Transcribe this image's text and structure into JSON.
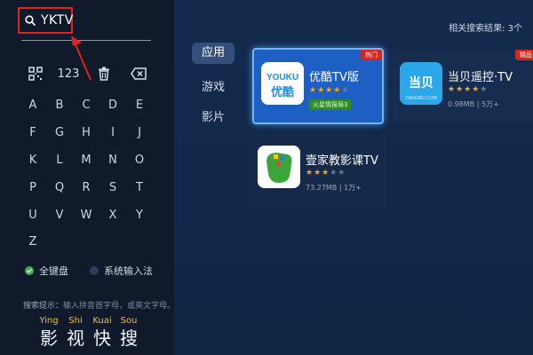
{
  "search": {
    "query": "YKTV",
    "icon": "search-icon"
  },
  "toolbar": {
    "qr_icon": "qr-code-icon",
    "numeric_label": "123",
    "trash_icon": "trash-icon",
    "backspace_icon": "backspace-icon"
  },
  "keyboard": {
    "rows": [
      [
        "A",
        "B",
        "C",
        "D",
        "E",
        "F"
      ],
      [
        "G",
        "H",
        "I",
        "J",
        "K",
        "L"
      ],
      [
        "M",
        "N",
        "O",
        "P",
        "Q",
        "R"
      ],
      [
        "S",
        "T",
        "U",
        "V",
        "W",
        "X"
      ],
      [
        "Y",
        "Z",
        "",
        "",
        "",
        ""
      ]
    ],
    "keys_col1": [
      "A",
      "G",
      "M",
      "S",
      "Y",
      "Z"
    ],
    "keys": {
      "A": "A",
      "B": "B",
      "C": "C",
      "D": "D",
      "E": "E",
      "F": "F",
      "G": "G",
      "H": "H",
      "I": "I",
      "J": "J",
      "K": "K",
      "L": "L",
      "M": "M",
      "N": "N",
      "O": "O",
      "P": "P",
      "Q": "Q",
      "R": "R",
      "S": "S",
      "T": "T",
      "U": "U",
      "V": "V",
      "W": "W",
      "X": "X",
      "Y": "Y",
      "Z": "Z"
    }
  },
  "input_modes": {
    "full_keyboard": "全键盘",
    "system_ime": "系统输入法",
    "selected": "full_keyboard"
  },
  "hint": {
    "label": "搜索提示：",
    "text": "输入拼音首字母，或英文字母。"
  },
  "pinyin_examples": [
    {
      "pinyin": "Ying",
      "hanzi": "影"
    },
    {
      "pinyin": "Shi",
      "hanzi": "视"
    },
    {
      "pinyin": "Kuai",
      "hanzi": "快"
    },
    {
      "pinyin": "Sou",
      "hanzi": "搜"
    }
  ],
  "results": {
    "count_label": "相关搜索结果: 3个"
  },
  "categories": [
    {
      "label": "应用",
      "active": true
    },
    {
      "label": "游戏",
      "active": false
    },
    {
      "label": "影片",
      "active": false
    }
  ],
  "apps": [
    {
      "name": "优酷TV版",
      "badge": "热门",
      "rating": 4.5,
      "tag": "火星情报局3",
      "icon_text_top": "YOUKU",
      "icon_text_bottom": "优酷",
      "selected": true
    },
    {
      "name": "当贝遥控·TV",
      "badge": "精品",
      "rating": 4,
      "meta": "0.98MB  |  5万+",
      "icon_text": "当贝",
      "icon_sub": "DANGBEI.COM",
      "selected": false
    },
    {
      "name": "壹家教影课TV",
      "badge": "",
      "rating": 3.5,
      "meta": "73.27MB  |  1万+",
      "selected": false
    }
  ],
  "colors": {
    "focus_border": "#e0231c",
    "selected_card": "#1d5fc2",
    "badge_red": "#d9251c",
    "star": "#f5a623",
    "pinyin": "#f1c232",
    "radio_on": "#3fae49"
  }
}
